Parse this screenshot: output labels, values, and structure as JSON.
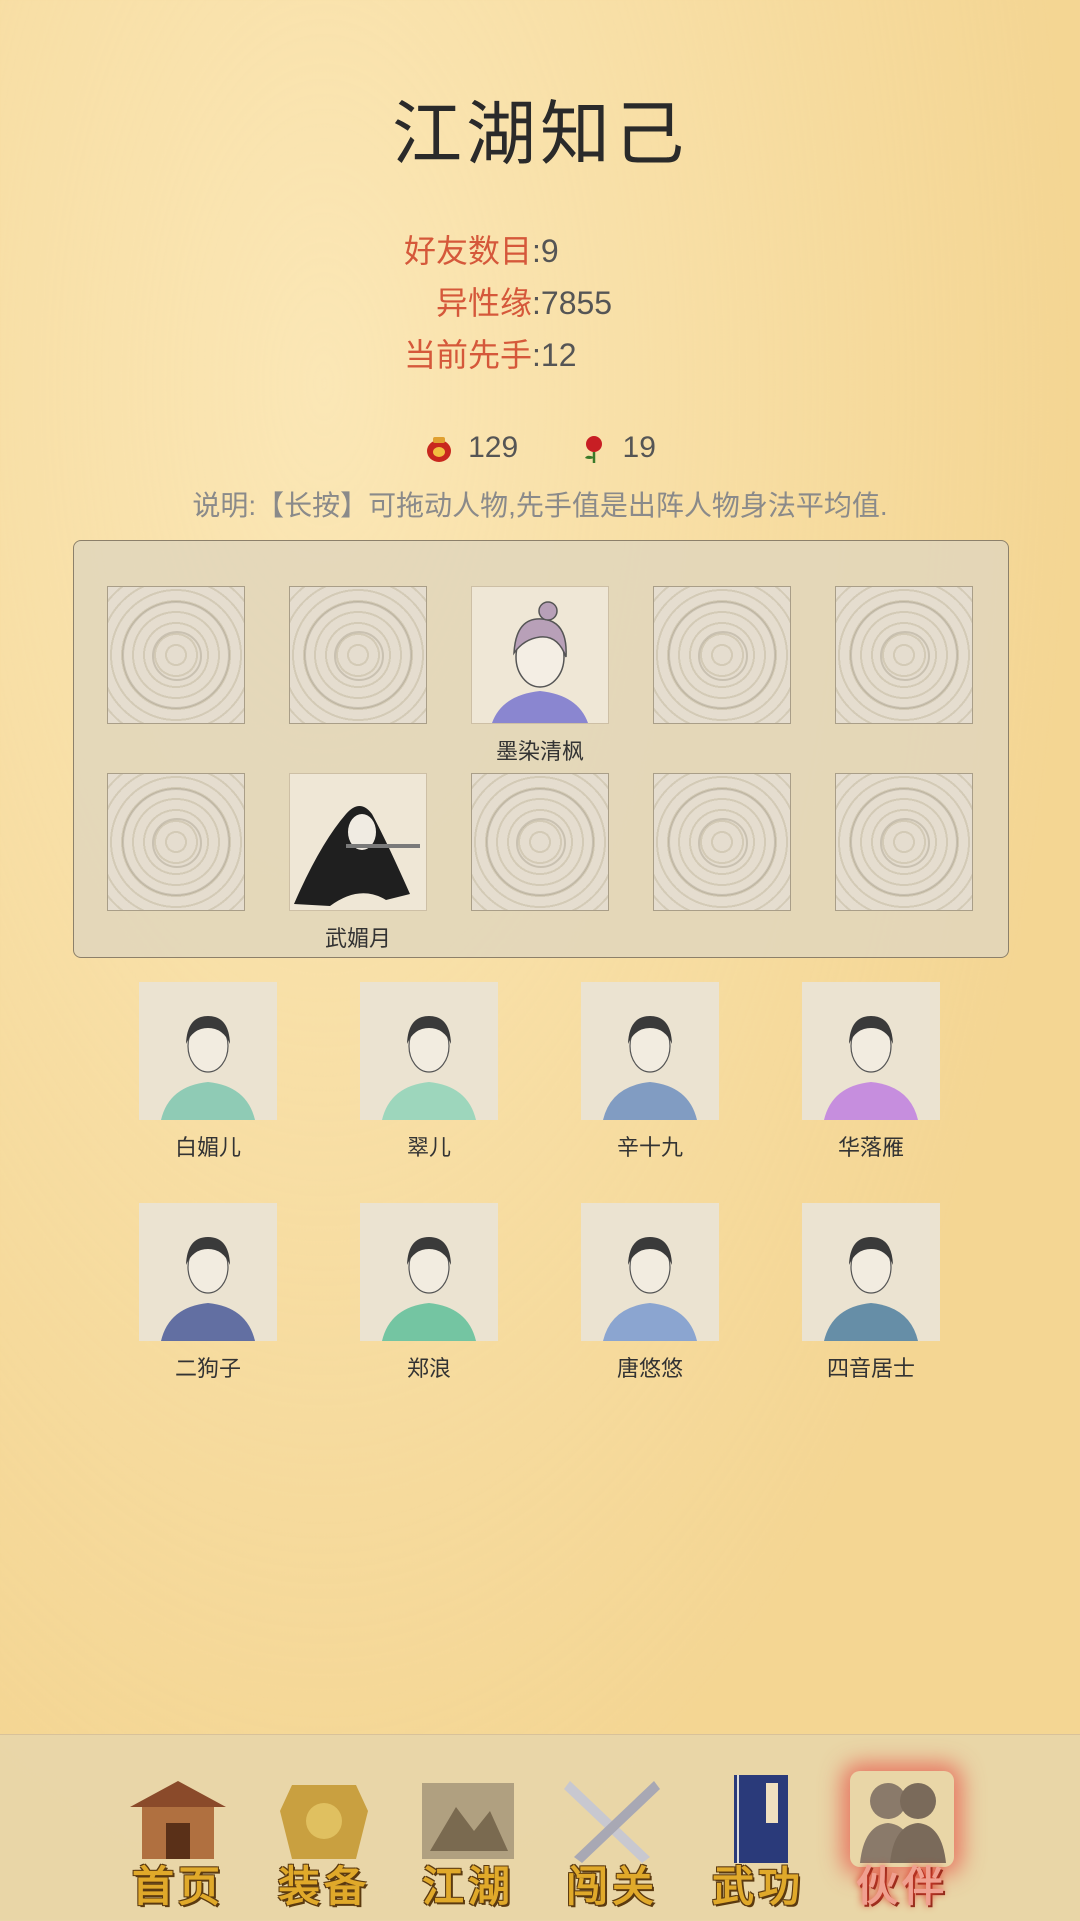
{
  "title": "江湖知己",
  "stats": [
    {
      "label": "好友数目",
      "value": "9"
    },
    {
      "label": "异性缘",
      "value": "7855"
    },
    {
      "label": "当前先手",
      "value": "12"
    }
  ],
  "resources": [
    {
      "icon": "wine-jar-icon",
      "value": "129"
    },
    {
      "icon": "rose-icon",
      "value": "19"
    }
  ],
  "note": "说明:【长按】可拖动人物,先手值是出阵人物身法平均值.",
  "formation": {
    "slots": [
      {
        "occupant": ""
      },
      {
        "occupant": ""
      },
      {
        "occupant": "墨染清枫"
      },
      {
        "occupant": ""
      },
      {
        "occupant": ""
      },
      {
        "occupant": ""
      },
      {
        "occupant": "武媚月"
      },
      {
        "occupant": ""
      },
      {
        "occupant": ""
      },
      {
        "occupant": ""
      }
    ]
  },
  "companions": [
    {
      "name": "白媚儿",
      "color": "#7fc7b0"
    },
    {
      "name": "翠儿",
      "color": "#8fd4b8"
    },
    {
      "name": "辛十九",
      "color": "#6f8fc0"
    },
    {
      "name": "华落雁",
      "color": "#c07fe0"
    },
    {
      "name": "二狗子",
      "color": "#4a5a9a"
    },
    {
      "name": "郑浪",
      "color": "#5fbf9a"
    },
    {
      "name": "唐悠悠",
      "color": "#7a9ad0"
    },
    {
      "name": "四音居士",
      "color": "#4f7fa0"
    }
  ],
  "nav": [
    {
      "label": "首页",
      "icon": "house-icon",
      "active": false
    },
    {
      "label": "装备",
      "icon": "armor-icon",
      "active": false
    },
    {
      "label": "江湖",
      "icon": "scroll-map-icon",
      "active": false
    },
    {
      "label": "闯关",
      "icon": "crossed-swords-icon",
      "active": false
    },
    {
      "label": "武功",
      "icon": "book-icon",
      "active": false
    },
    {
      "label": "伙伴",
      "icon": "companions-icon",
      "active": true
    }
  ]
}
